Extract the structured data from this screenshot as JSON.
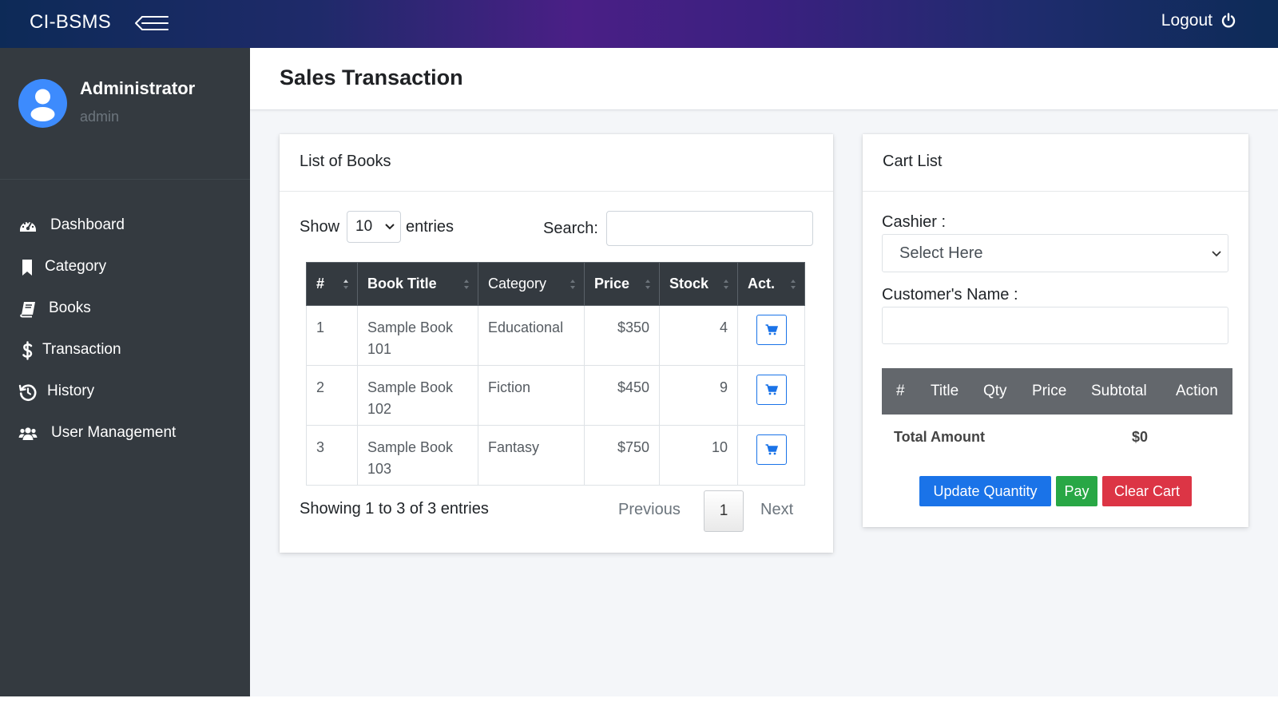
{
  "topbar": {
    "brand": "CI-BSMS",
    "logout_label": "Logout"
  },
  "user": {
    "name": "Administrator",
    "role": "admin"
  },
  "sidebar": {
    "items": [
      {
        "label": "Dashboard",
        "icon": "tachometer-icon"
      },
      {
        "label": "Category",
        "icon": "bookmark-icon"
      },
      {
        "label": "Books",
        "icon": "book-icon"
      },
      {
        "label": "Transaction",
        "icon": "dollar-icon"
      },
      {
        "label": "History",
        "icon": "history-icon"
      },
      {
        "label": "User Management",
        "icon": "users-icon"
      }
    ]
  },
  "page": {
    "title": "Sales Transaction"
  },
  "books_card": {
    "title": "List of Books",
    "show_label": "Show",
    "entries_value": "10",
    "entries_label": "entries",
    "search_label": "Search:",
    "search_value": "",
    "columns": [
      "#",
      "Book Title",
      "Category",
      "Price",
      "Stock",
      "Act."
    ],
    "rows": [
      {
        "num": "1",
        "title": "Sample Book 101",
        "category": "Educational",
        "price": "$350",
        "stock": "4"
      },
      {
        "num": "2",
        "title": "Sample Book 102",
        "category": "Fiction",
        "price": "$450",
        "stock": "9"
      },
      {
        "num": "3",
        "title": "Sample Book 103",
        "category": "Fantasy",
        "price": "$750",
        "stock": "10"
      }
    ],
    "info": "Showing 1 to 3 of 3 entries",
    "pagination": {
      "previous": "Previous",
      "current": "1",
      "next": "Next"
    }
  },
  "cart_card": {
    "title": "Cart List",
    "cashier_label": "Cashier :",
    "cashier_placeholder": "Select Here",
    "customer_label": "Customer's Name :",
    "customer_value": "",
    "columns": [
      "#",
      "Title",
      "Qty",
      "Price",
      "Subtotal",
      "Action"
    ],
    "total_label": "Total Amount",
    "total_value": "$0",
    "buttons": {
      "update": "Update Quantity",
      "pay": "Pay",
      "clear": "Clear Cart"
    }
  },
  "colors": {
    "primary": "#1a73e8",
    "success": "#28a745",
    "danger": "#dc3545",
    "sidebar": "#343a40",
    "table_header": "#343a40"
  }
}
